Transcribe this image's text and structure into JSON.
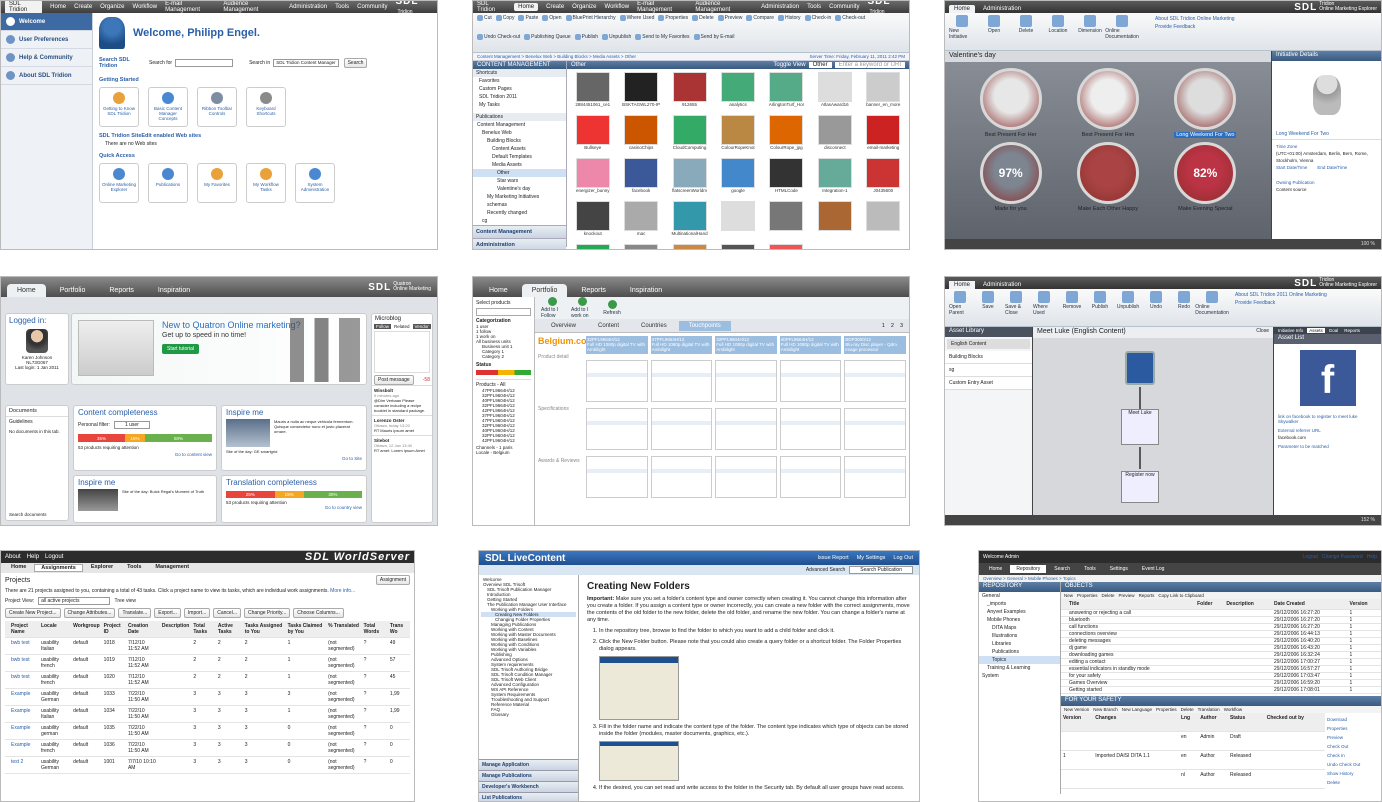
{
  "t1": {
    "nav": [
      "SDL Tridion",
      "Home",
      "Create",
      "Organize",
      "Workflow",
      "E-mail Management",
      "Audience Management",
      "Administration",
      "Tools",
      "Community"
    ],
    "sidebar": [
      "Welcome",
      "User Preferences",
      "Help & Community",
      "About SDL Tridion"
    ],
    "welcome": "Welcome, Philipp Engel.",
    "search_title": "Search SDL Tridion",
    "search_for": "Search for",
    "search_in": "Search in",
    "search_in_value": "SDL Tridion Content Manager",
    "search_btn": "Search",
    "getting_started": "Getting Started",
    "gs_items": [
      "Getting to Know SDL Tridion",
      "Basic Content Manager Concepts",
      "Ribbon Toolbar Controls",
      "Keyboard Shortcuts"
    ],
    "sites_title": "SDL Tridion SiteEdit enabled Web sites",
    "sites_empty": "There are no Web sites",
    "quick_access": "Quick Access",
    "qa_items": [
      "Online Marketing Explorer",
      "Publications",
      "My Favorites",
      "My Workflow Tasks",
      "System Administration"
    ]
  },
  "t2": {
    "nav": [
      "SDL Tridion",
      "Home",
      "Create",
      "Organize",
      "Workflow",
      "E-mail Management",
      "Audience Management",
      "Administration",
      "Tools",
      "Community"
    ],
    "ribbon": [
      "Cut",
      "Copy",
      "Paste",
      "Open",
      "BluePrint Hierarchy",
      "Where Used",
      "Properties",
      "Delete",
      "Preview",
      "Compare",
      "History",
      "Check-in",
      "Check-out",
      "Undo Check-out",
      "Publishing Queue",
      "Publish",
      "Unpublish",
      "Send to My Favorites",
      "Send by E-mail"
    ],
    "breadcrumb": "Content Management > Benelux Web > Building Blocks > Media Assets > Other",
    "server_time": "Server Time: Friday, February 11, 2011 2:42 PM",
    "panel_title": "CONTENT MANAGEMENT",
    "shortcuts": "Shortcuts",
    "shortcut_items": [
      "Favorites",
      "Custom Pages",
      "SDL Tridion 2011",
      "My Tasks"
    ],
    "publications": "Publications",
    "tree": [
      "Content Management",
      "Benelux Web",
      "Building Blocks",
      "Content Assets",
      "Default Templates",
      "Media Assets",
      "Other",
      "Star wars",
      "Valentine's day",
      "My Marketing Initiatives",
      "schemas",
      "Recently changed",
      "cg"
    ],
    "bottom_nav": [
      "Content Management",
      "Administration"
    ],
    "folder": "Other",
    "toggle_view": "Toggle View",
    "filter_value": "Other",
    "filter_placeholder": "Enter a keyword or URI",
    "thumbs": [
      "2884451061_ce1",
      "BSKTAGWL270-IP",
      "912655",
      "analytics",
      "ArlingtonTurf_Hor",
      "AtlasAward16",
      "banner_en_more",
      "Bullseye",
      "casinoChips",
      "CloudComputing",
      "ColourRopeKnot",
      "ColourRope_jpg",
      "disconnect",
      "email-marketing",
      "energizer_bunny",
      "facebook",
      "flatscreenWorldm",
      "google",
      "HTMLCode",
      "Integration-1",
      "J0435600",
      "knockout",
      "mac",
      "MultinationalHand",
      "",
      "",
      "",
      "",
      "",
      "",
      "",
      "",
      ""
    ]
  },
  "t3": {
    "tabs": [
      "Home",
      "Administration"
    ],
    "ribbon": [
      "New Initiative",
      "Open",
      "Delete",
      "Location",
      "Dimension",
      "Online Documentation"
    ],
    "links": [
      "About SDL Tridion Online Marketing",
      "Provide Feedback"
    ],
    "groups": [
      "Initiative",
      "SharePoint",
      "Settings & Help"
    ],
    "title": "Valentine's day",
    "items": [
      "Best Present For Her",
      "Best Present For Him",
      "Long Weekend For Two",
      "Made for you",
      "Make Each Other Happy",
      "Make Evening Special"
    ],
    "pcts": [
      "97%",
      "82%"
    ],
    "volume": "Volume",
    "details_title": "Initiative Details",
    "detail_name": "Long Weekend For Two",
    "time_zone": "Time Zone",
    "tz_value": "(UTC+01:00) Amsterdam, Berlin, Bern, Rome, Stockholm, Vienna",
    "start": "Start Date/Time",
    "end": "End Date/Time",
    "owning": "Owning Publication",
    "content_source": "Content source",
    "zoom": "100 %"
  },
  "t4": {
    "tabs": [
      "Home",
      "Portfolio",
      "Reports",
      "Inspiration"
    ],
    "logged": "Logged in:",
    "user": "Karen Johnson",
    "user_id": "NL73G067",
    "last": "Last login: 1 Jan 2011",
    "promo": "New to Quatron Online marketing?",
    "promo_sub": "Get up to speed in no time!",
    "promo_btn": "Start tutorial",
    "microblog": "Microblog",
    "mb_tabs": [
      "Follow",
      "Related",
      "Vendor"
    ],
    "post": "Post message",
    "count": "-58",
    "docs": "Documents",
    "guidelines": "Guidelines",
    "no_docs": "No documents in this tab.",
    "search_docs": "Search documents",
    "c1": "Content completeness",
    "pf": "Personal filter:",
    "pf_val": "1 user",
    "bars1": [
      "35%",
      "15%",
      "50%"
    ],
    "req1": "53 products requiring attention",
    "goto1": "Go to content view",
    "inspire": "Inspire me",
    "lorem": "Mauris a nulla ac neque vehicula fermentum. Quisque consectetur nunc et justo placerat ornare.",
    "site1": "Site of the day: GE smartgrid",
    "goto_site": "Go to Site",
    "inspire2": "Inspire me",
    "site2": "Site of the day: Buick Regal's Moment of Truth",
    "c2": "Translation completeness",
    "bars2": [
      "25%",
      "15%",
      "30%"
    ],
    "pf2_val": "1 user",
    "req2": "53 products requiring attention",
    "goto2": "Go to country view",
    "posts": [
      {
        "who": "Winsbolt",
        "when": "5 minutes ago",
        "text": "@Dim Verbaan Please consider including a recipe booklet in standard package."
      },
      {
        "who": "Lorenzo Oster",
        "when": "Ottawa, today 13:20",
        "text": "RT Mauris ipsum amet"
      },
      {
        "who": "Sitebot",
        "when": "Ottawa, 12 Jan 13:40",
        "text": "RT amet. Lorem ipsum Amet"
      }
    ]
  },
  "t5": {
    "tabs": [
      "Home",
      "Portfolio",
      "Reports",
      "Inspiration"
    ],
    "select": "Select products",
    "cat": "Categorization",
    "cats": [
      "1 user",
      "1 follow",
      "1 work on",
      "All business units",
      "Business unit 1",
      "Category 1",
      "Category 2"
    ],
    "status": "Status",
    "products": "Products - All",
    "codes": [
      "47PFL9664H/12",
      "32PFL9604H/12",
      "40PFL9604H/12",
      "32PFL9664H/12",
      "42PFL9664H/12",
      "37PFL9604H/12",
      "47PFL9604H/12",
      "32PFL9604H/12",
      "40PFL9604H/12",
      "32PFL9604H/12",
      "42PFL9604H/12"
    ],
    "channels": "Channels - 1 paris",
    "locale": "Locale - Belgium",
    "actions": [
      "Add to I Follow",
      "Add to I work on",
      "Refresh"
    ],
    "vtabs": [
      "Overview",
      "Content",
      "Countries",
      "Touchpoints"
    ],
    "pages": [
      "1",
      "2",
      "3"
    ],
    "belgium": "Belgium.com",
    "sections": [
      "Product detail",
      "Specifications",
      "Awards & Reviews"
    ],
    "cols": [
      "32PFL9664H/12",
      "47PFL9664H/12",
      "32PFL9604H/12",
      "40PFL9664H/12",
      "BDP3000/12"
    ],
    "col_desc": [
      "Full HD 1080p digital TV with Ambilight",
      "Full HD 1080p digital TV with Ambilight",
      "Full HD 1080p digital TV with Ambilight",
      "Full HD 1080p digital TV with Ambilight",
      "Blu-ray Disc player - Qdm image processor"
    ]
  },
  "t6": {
    "tabs": [
      "Home",
      "Administration"
    ],
    "ribbon": [
      "Open Parent",
      "Save",
      "Save & Close",
      "Where Used",
      "Remove",
      "Publish",
      "Unpublish",
      "Undo",
      "Redo",
      "Online Documentation"
    ],
    "links": [
      "About SDL Tridion 2011 Online Marketing",
      "Provide Feedback"
    ],
    "groups": [
      "Initiative",
      "Assets",
      "Edit",
      "Settings & Help"
    ],
    "lib": "Asset Library",
    "lib_sel": "English Content",
    "lib_items": [
      "Building Blocks",
      "sg",
      "Custom Entry Asset"
    ],
    "flow_title": "Meet Luke (English Content)",
    "close": "Close",
    "nodes": [
      "Meet Luke",
      "Register now"
    ],
    "detail_tabs": [
      "Initiative Info",
      "Assets",
      "Goal",
      "Reports"
    ],
    "asset_list": "Asset List",
    "fb_caption": "link on facebook to register to meet luke Skywalker",
    "ext_ref": "External referrer URL",
    "ext_val": "facebook.com",
    "param": "Parameter to be matched",
    "zoom": "152 %"
  },
  "t7": {
    "top": [
      "About",
      "Help",
      "Logout"
    ],
    "brand": "SDL WorldServer",
    "tabs": [
      "Home",
      "Assignments",
      "Explorer",
      "Tools",
      "Management"
    ],
    "title": "Projects",
    "assign_btn": "Assignment",
    "info": "There are 21 projects assigned to you, containing a total of 43 tasks. Click a project name to view its tasks, which are individual work assignments.",
    "more": "More info...",
    "view_label": "Project View:",
    "view_val": "all active projects",
    "tree_view": "Tree view",
    "buttons": [
      "Create New Project...",
      "Change Attributes...",
      "Translate...",
      "Export...",
      "Import...",
      "Cancel...",
      "Change Priority...",
      "Choose Columns..."
    ],
    "headers": [
      "",
      "Project Name",
      "Locale",
      "Workgroup",
      "Project ID",
      "Creation Date",
      "Description",
      "Total Tasks",
      "Active Tasks",
      "Tasks Assigned to You",
      "Tasks Claimed by You",
      "% Translated",
      "Total Words",
      "Trans Wo"
    ],
    "rows": [
      [
        "bwb test",
        "usability Italian",
        "default",
        "1018",
        "7/12/10 11:52 AM",
        "",
        "2",
        "2",
        "2",
        "1",
        "(not segmented)",
        "?",
        "49"
      ],
      [
        "bwb test",
        "usability french",
        "default",
        "1019",
        "7/12/10 11:52 AM",
        "",
        "2",
        "2",
        "2",
        "1",
        "(not segmented)",
        "?",
        "57"
      ],
      [
        "bwb test",
        "usability french",
        "default",
        "1020",
        "7/12/10 11:52 AM",
        "",
        "2",
        "2",
        "2",
        "1",
        "(not segmented)",
        "?",
        "45"
      ],
      [
        "Example",
        "usability German",
        "default",
        "1033",
        "7/22/10 11:50 AM",
        "",
        "3",
        "3",
        "3",
        "3",
        "(not segmented)",
        "?",
        "1,99"
      ],
      [
        "Example",
        "usability Italian",
        "default",
        "1034",
        "7/22/10 11:50 AM",
        "",
        "3",
        "3",
        "3",
        "1",
        "(not segmented)",
        "?",
        "1,99"
      ],
      [
        "Example",
        "usability german",
        "default",
        "1035",
        "7/22/10 11:50 AM",
        "",
        "3",
        "3",
        "3",
        "0",
        "(not segmented)",
        "?",
        "0"
      ],
      [
        "Example",
        "usability french",
        "default",
        "1036",
        "7/22/10 11:50 AM",
        "",
        "3",
        "3",
        "3",
        "0",
        "(not segmented)",
        "?",
        "0"
      ],
      [
        "test 2",
        "usability German",
        "default",
        "1001",
        "7/7/10 10:10 AM",
        "",
        "3",
        "3",
        "3",
        "0",
        "(not segmented)",
        "?",
        "0"
      ]
    ]
  },
  "t8": {
    "brand": "SDL LiveContent",
    "links": [
      "Issue Report",
      "My Settings",
      "Log Out"
    ],
    "adv": "Advanced Search",
    "search_val": "Search Publication",
    "toc": [
      "Welcome",
      "Overview SDL Trisoft",
      "SDL Trisoft Publication Manager",
      "Introduction",
      "Getting Started",
      "The Publication Manager User Interface",
      "Working with Folders",
      "Creating New Folders",
      "Changing Folder Properties",
      "Managing Publications",
      "Working with Content",
      "Working with Master Documents",
      "Working with Baselines",
      "Working with Conditions",
      "Working with Variables",
      "Publishing",
      "Advanced Options",
      "System requirements",
      "SDL Trisoft Authoring Bridge",
      "SDL Trisoft Condition Manager",
      "SDL Trisoft Web Client",
      "Advanced Configuration",
      "WS API Reference",
      "System Requirements",
      "Troubleshooting and Support",
      "Reference Material",
      "FAQ",
      "Glossary"
    ],
    "bottom": [
      "Manage Application",
      "Manage Publications",
      "Developer's Workbench",
      "List Publications"
    ],
    "heading": "Creating New Folders",
    "important": "Important:",
    "imp_text": "Make sure you set a folder's content type and owner correctly when creating it. You cannot change this information after you create a folder. If you assign a content type or owner incorrectly, you can create a new folder with the correct assignments, move the contents of the old folder to the new folder, delete the old folder, and rename the new folder. You can change a folder's name at any time.",
    "steps": [
      "In the repository tree, browse to find the folder to which you want to add a child folder and click it.",
      "Click the New Folder button. Please note that you could also create a query folder or a shortcut folder. The Folder Properties dialog appears.",
      "Fill in the folder name and indicate the content type of the folder. The content type indicates which type of objects can be stored inside the folder (modules, master documents, graphics, etc.).",
      "If the desired, you can set read and write access to the folder in the Security tab. By default all user groups have read access."
    ]
  },
  "t9": {
    "welcome": "Welcome Admin",
    "top_links": [
      "Logout",
      "Change Password",
      "Help"
    ],
    "tabs": [
      "Home",
      "Repository",
      "Search",
      "Tools",
      "Settings",
      "Event Log"
    ],
    "crumb": "Overview > General > Mobile Phones > Topics",
    "repo": "REPOSITORY",
    "tree": [
      "General",
      "_imports",
      "Anyvet Examples",
      "Mobile Phones",
      "DITA Maps",
      "Illustrations",
      "Libraries",
      "Publications",
      "Topics",
      "Training & Learning",
      "System"
    ],
    "objects": "OBJECTS",
    "obj_actions": [
      "New",
      "Properties",
      "Delete",
      "Preview",
      "Reports",
      "Copy Link to Clipboard"
    ],
    "obj_headers": [
      "",
      "Title",
      "Folder",
      "Description",
      "Date Created",
      "Version"
    ],
    "obj_rows": [
      [
        "answering or rejecting a call",
        "",
        "",
        "29/12/2006 16:27:20",
        "1"
      ],
      [
        "bluetooth",
        "",
        "",
        "29/12/2006 16:27:20",
        "1"
      ],
      [
        "call functions",
        "",
        "",
        "29/12/2006 16:27:20",
        "1"
      ],
      [
        "connections overview",
        "",
        "",
        "29/12/2006 16:44:13",
        "1"
      ],
      [
        "deleting messages",
        "",
        "",
        "29/12/2006 16:40:20",
        "1"
      ],
      [
        "dj game",
        "",
        "",
        "29/12/2006 16:43:20",
        "1"
      ],
      [
        "downloading games",
        "",
        "",
        "29/12/2006 16:32:24",
        "1"
      ],
      [
        "editing a contact",
        "",
        "",
        "29/12/2006 17:00:27",
        "1"
      ],
      [
        "essential indicators in standby mode",
        "",
        "",
        "29/12/2006 16:57:27",
        "1"
      ],
      [
        "for your safety",
        "",
        "",
        "29/12/2006 17:03:47",
        "1"
      ],
      [
        "Games Overview",
        "",
        "",
        "29/12/2006 16:59:20",
        "1"
      ],
      [
        "Getting started",
        "",
        "",
        "29/12/2006 17:08:01",
        "1"
      ]
    ],
    "safety": "FOR YOUR SAFETY",
    "safety_actions": [
      "New Version",
      "New Branch",
      "New Language",
      "Properties",
      "Delete",
      "Translation",
      "Workflow"
    ],
    "safety_headers": [
      "Version",
      "Changes",
      "Lng",
      "Author",
      "Status",
      "Checked out by"
    ],
    "safety_rows": [
      [
        "",
        "",
        "en",
        "Admin",
        "Draft",
        ""
      ],
      [
        "1",
        "Imported DAISI DITA 1.1",
        "en",
        "Author",
        "Released",
        ""
      ],
      [
        "",
        "",
        "nl",
        "Author",
        "Released",
        ""
      ]
    ],
    "side_actions": [
      "Download",
      "Properties",
      "Preview",
      "Check Out",
      "Check In",
      "Undo Check Out",
      "Show History",
      "Delete"
    ]
  }
}
